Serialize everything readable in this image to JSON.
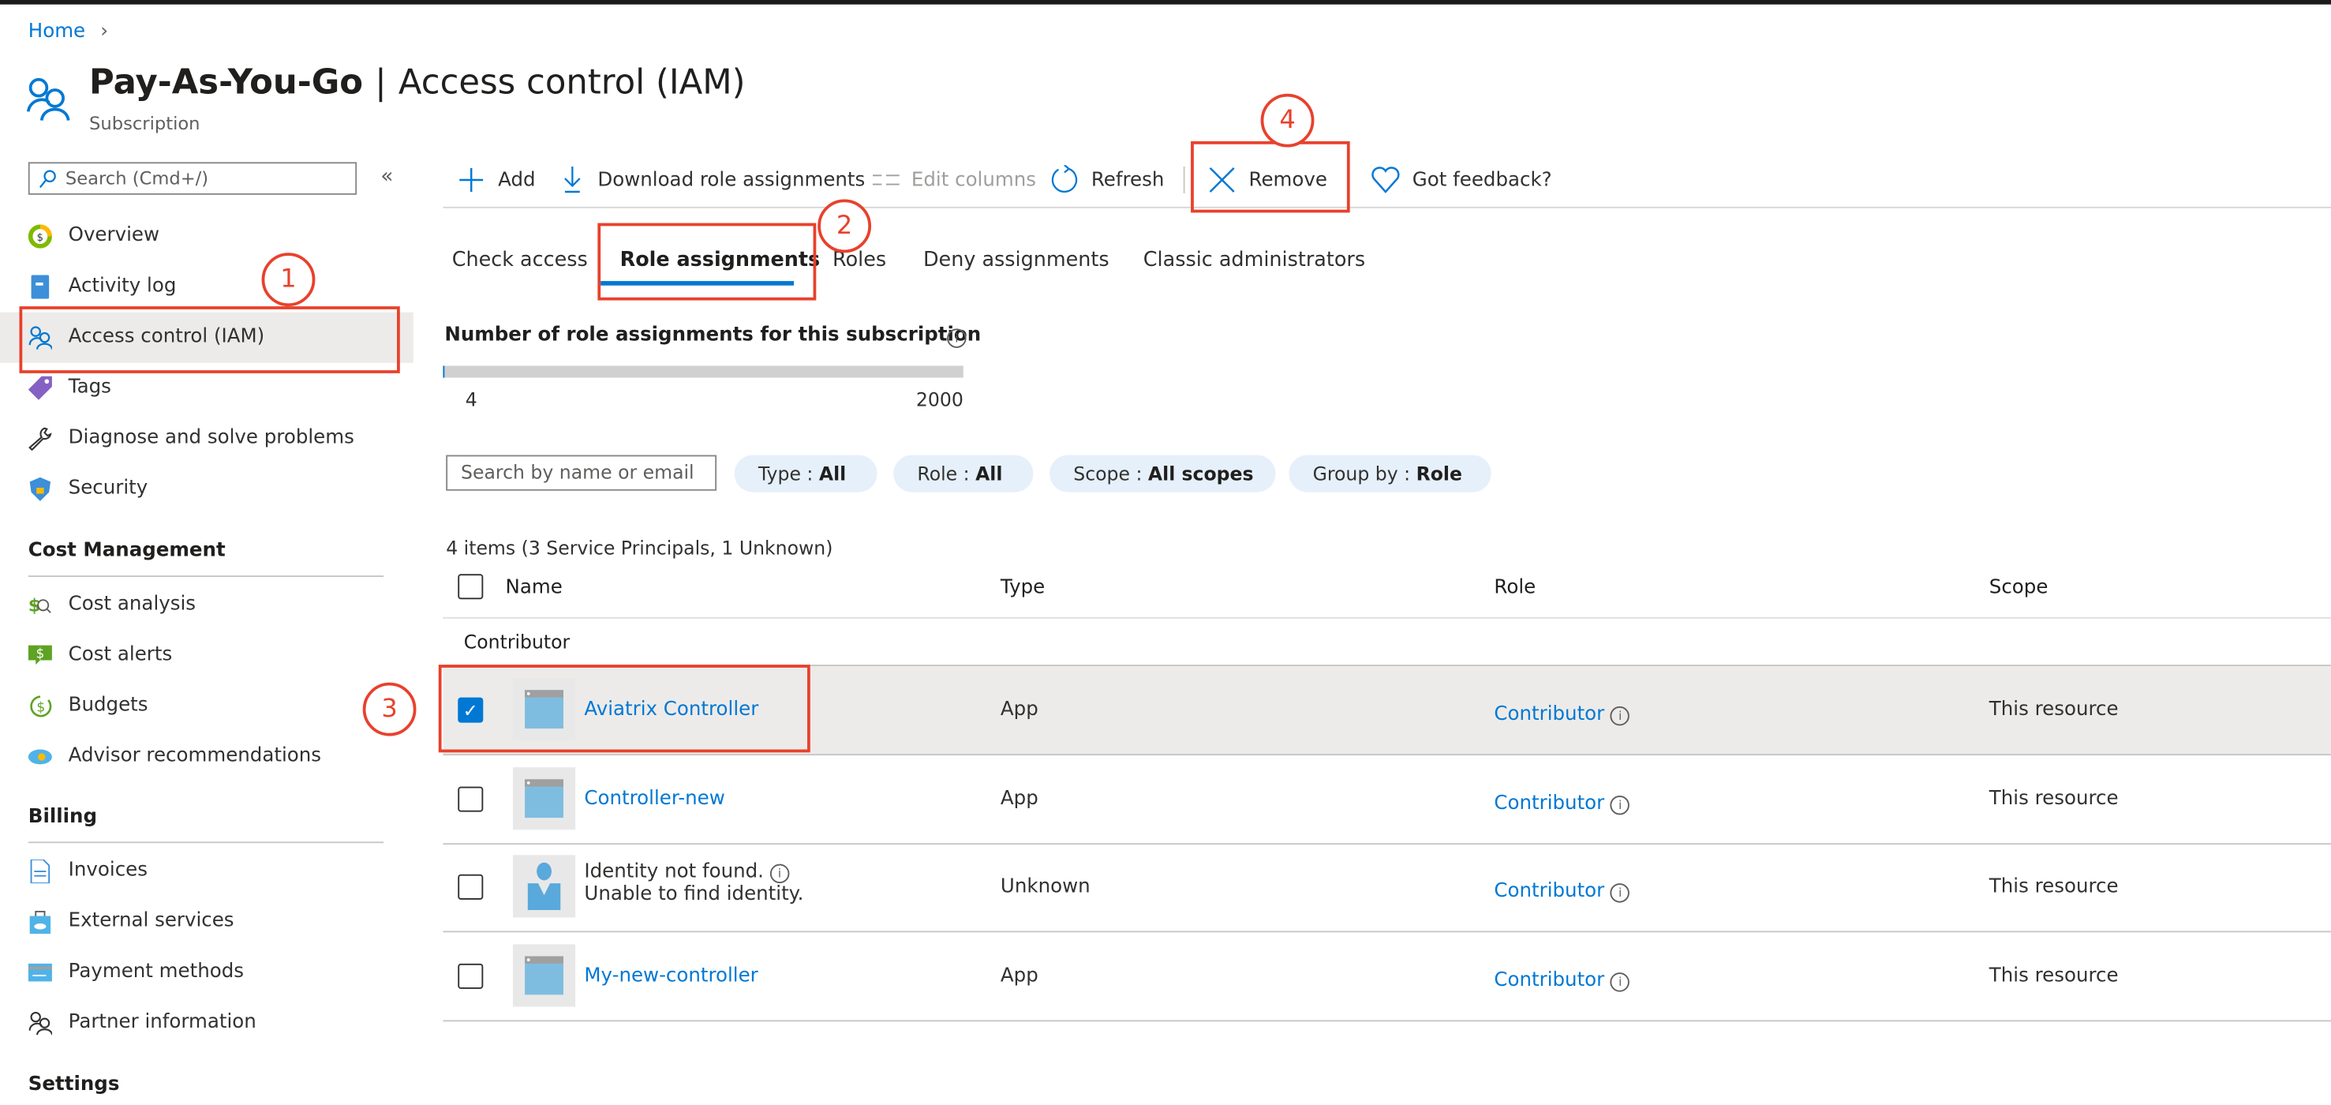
{
  "breadcrumb": {
    "home": "Home",
    "separator": "›"
  },
  "header": {
    "resource": "Pay-As-You-Go",
    "separator": "|",
    "page": "Access control (IAM)",
    "subtitle": "Subscription"
  },
  "sidebar": {
    "search_placeholder": "Search (Cmd+/)",
    "collapse": "«",
    "items": [
      {
        "label": "Overview",
        "icon": "overview-icon"
      },
      {
        "label": "Activity log",
        "icon": "activity-log-icon"
      },
      {
        "label": "Access control (IAM)",
        "icon": "people-icon",
        "active": true
      },
      {
        "label": "Tags",
        "icon": "tag-icon"
      },
      {
        "label": "Diagnose and solve problems",
        "icon": "wrench-icon"
      },
      {
        "label": "Security",
        "icon": "shield-icon"
      }
    ],
    "sections": [
      {
        "title": "Cost Management",
        "items": [
          "Cost analysis",
          "Cost alerts",
          "Budgets",
          "Advisor recommendations"
        ]
      },
      {
        "title": "Billing",
        "items": [
          "Invoices",
          "External services",
          "Payment methods",
          "Partner information"
        ]
      },
      {
        "title": "Settings",
        "items": []
      }
    ]
  },
  "toolbar": {
    "add": "Add",
    "download": "Download role assignments",
    "edit_columns": "Edit columns",
    "refresh": "Refresh",
    "remove": "Remove",
    "feedback": "Got feedback?"
  },
  "tabs": [
    "Check access",
    "Role assignments",
    "Roles",
    "Deny assignments",
    "Classic administrators"
  ],
  "active_tab": "Role assignments",
  "usage": {
    "label": "Number of role assignments for this subscription",
    "current": "4",
    "max": "2000",
    "fraction": 0.002
  },
  "filters": {
    "search_placeholder": "Search by name or email",
    "pills": [
      {
        "key": "Type : ",
        "value": "All"
      },
      {
        "key": "Role : ",
        "value": "All"
      },
      {
        "key": "Scope : ",
        "value": "All scopes"
      },
      {
        "key": "Group by : ",
        "value": "Role"
      }
    ]
  },
  "table": {
    "count": "4 items (3 Service Principals, 1 Unknown)",
    "columns": [
      "Name",
      "Type",
      "Role",
      "Scope"
    ],
    "group": "Contributor",
    "rows": [
      {
        "name": "Aviatrix Controller",
        "name2": "",
        "type": "App",
        "role": "Contributor",
        "scope": "This resource",
        "checked": true,
        "icon": "app-icon"
      },
      {
        "name": "Controller-new",
        "name2": "",
        "type": "App",
        "role": "Contributor",
        "scope": "This resource",
        "checked": false,
        "icon": "app-icon"
      },
      {
        "name": "Identity not found.",
        "name2": "Unable to find identity.",
        "type": "Unknown",
        "role": "Contributor",
        "scope": "This resource",
        "checked": false,
        "icon": "unknown-user-icon"
      },
      {
        "name": "My-new-controller",
        "name2": "",
        "type": "App",
        "role": "Contributor",
        "scope": "This resource",
        "checked": false,
        "icon": "app-icon"
      }
    ]
  },
  "annotations": [
    "1",
    "2",
    "3",
    "4"
  ],
  "colors": {
    "accent": "#0078d4",
    "annotation": "#e8412c",
    "selected_row": "#edebe9",
    "pill": "#e6f0fb"
  }
}
